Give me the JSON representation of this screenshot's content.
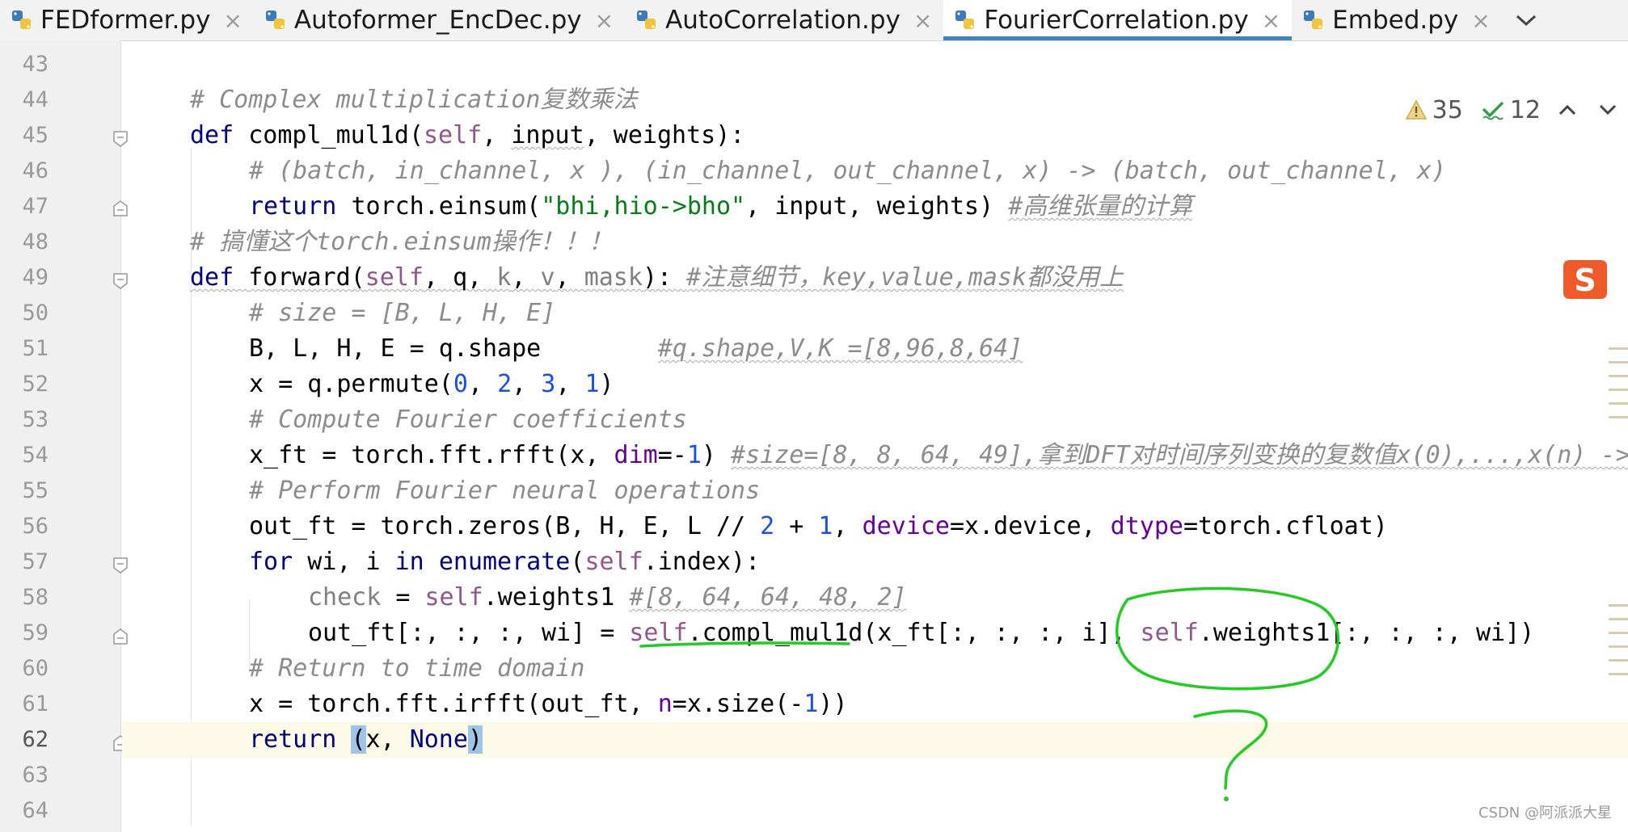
{
  "tabs": [
    {
      "label": "FEDformer.py",
      "active": false
    },
    {
      "label": "Autoformer_EncDec.py",
      "active": false
    },
    {
      "label": "AutoCorrelation.py",
      "active": false
    },
    {
      "label": "FourierCorrelation.py",
      "active": true
    },
    {
      "label": "Embed.py",
      "active": false
    }
  ],
  "tab_close_glyph": "×",
  "inspections": {
    "warnings": "35",
    "weak_warnings": "12"
  },
  "editor": {
    "current_line": "62",
    "lines": [
      {
        "n": "43"
      },
      {
        "n": "44",
        "text": "# Complex multiplication复数乘法"
      },
      {
        "n": "45",
        "text": "def compl_mul1d(self, input, weights):"
      },
      {
        "n": "46",
        "text": "# (batch, in_channel, x ), (in_channel, out_channel, x) -> (batch, out_channel, x)"
      },
      {
        "n": "47",
        "text": "return torch.einsum(\"bhi,hio->bho\", input, weights) #高维张量的计算"
      },
      {
        "n": "48",
        "text": "# 搞懂这个torch.einsum操作！！！"
      },
      {
        "n": "49",
        "text": "def forward(self, q, k, v, mask): #注意细节，key,value,mask都没用上"
      },
      {
        "n": "50",
        "text": "# size = [B, L, H, E]"
      },
      {
        "n": "51",
        "text": "B, L, H, E = q.shape        #q.shape,V,K =[8,96,8,64]"
      },
      {
        "n": "52",
        "text": "x = q.permute(0, 2, 3, 1)"
      },
      {
        "n": "53",
        "text": "# Compute Fourier coefficients"
      },
      {
        "n": "54",
        "text": "x_ft = torch.fft.rfft(x, dim=-1) #size=[8, 8, 64, 49],拿到DFT对时间序列变换的复数值x(0),...,x(n) ->"
      },
      {
        "n": "55",
        "text": "# Perform Fourier neural operations"
      },
      {
        "n": "56",
        "text": "out_ft = torch.zeros(B, H, E, L // 2 + 1, device=x.device, dtype=torch.cfloat)"
      },
      {
        "n": "57",
        "text": "for wi, i in enumerate(self.index):"
      },
      {
        "n": "58",
        "text": "check = self.weights1 #[8, 64, 64, 48, 2]"
      },
      {
        "n": "59",
        "text": "out_ft[:, :, :, wi] = self.compl_mul1d(x_ft[:, :, :, i], self.weights1[:, :, :, wi])"
      },
      {
        "n": "60",
        "text": "# Return to time domain"
      },
      {
        "n": "61",
        "text": "x = torch.fft.irfft(out_ft, n=x.size(-1))"
      },
      {
        "n": "62",
        "text": "return (x, None)"
      },
      {
        "n": "63"
      },
      {
        "n": "64"
      }
    ]
  },
  "colors": {
    "keyword": "#000080",
    "self": "#94558d",
    "number": "#1750eb",
    "string": "#067d17",
    "named_param": "#660099",
    "comment": "#8c8c8c",
    "active_tab_underline": "#4083c9",
    "annotation": "#22cc22"
  },
  "annotation": {
    "question_mark": "?"
  },
  "ime_badge_glyph": "S",
  "watermark": "CSDN @阿派派大星"
}
